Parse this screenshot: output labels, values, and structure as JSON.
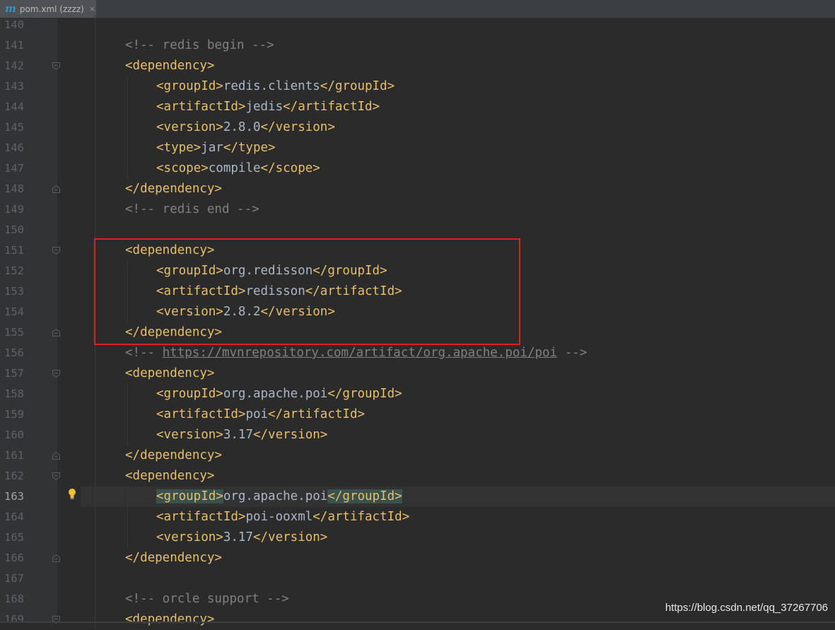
{
  "tab": {
    "icon": "maven-m-icon",
    "label": "pom.xml (zzzz)",
    "close": "×",
    "letter": "m"
  },
  "current_line": "163",
  "lines": [
    {
      "n": "140",
      "indent": 0,
      "parts": []
    },
    {
      "n": "141",
      "indent": 0,
      "parts": [
        [
          "cmt",
          "<!-- redis begin -->"
        ]
      ]
    },
    {
      "n": "142",
      "indent": 0,
      "fold": "open",
      "parts": [
        [
          "tag",
          "<dependency>"
        ]
      ]
    },
    {
      "n": "143",
      "indent": 1,
      "parts": [
        [
          "tag",
          "<groupId>"
        ],
        [
          "txt",
          "redis.clients"
        ],
        [
          "tag",
          "</groupId>"
        ]
      ]
    },
    {
      "n": "144",
      "indent": 1,
      "parts": [
        [
          "tag",
          "<artifactId>"
        ],
        [
          "txt",
          "jedis"
        ],
        [
          "tag",
          "</artifactId>"
        ]
      ]
    },
    {
      "n": "145",
      "indent": 1,
      "parts": [
        [
          "tag",
          "<version>"
        ],
        [
          "txt",
          "2.8.0"
        ],
        [
          "tag",
          "</version>"
        ]
      ]
    },
    {
      "n": "146",
      "indent": 1,
      "parts": [
        [
          "tag",
          "<type>"
        ],
        [
          "txt",
          "jar"
        ],
        [
          "tag",
          "</type>"
        ]
      ]
    },
    {
      "n": "147",
      "indent": 1,
      "parts": [
        [
          "tag",
          "<scope>"
        ],
        [
          "txt",
          "compile"
        ],
        [
          "tag",
          "</scope>"
        ]
      ]
    },
    {
      "n": "148",
      "indent": 0,
      "fold": "close",
      "parts": [
        [
          "tag",
          "</dependency>"
        ]
      ]
    },
    {
      "n": "149",
      "indent": 0,
      "parts": [
        [
          "cmt",
          "<!-- redis end -->"
        ]
      ]
    },
    {
      "n": "150",
      "indent": 0,
      "parts": []
    },
    {
      "n": "151",
      "indent": 0,
      "fold": "open",
      "parts": [
        [
          "tag",
          "<dependency>"
        ]
      ]
    },
    {
      "n": "152",
      "indent": 1,
      "parts": [
        [
          "tag",
          "<groupId>"
        ],
        [
          "txt",
          "org.redisson"
        ],
        [
          "tag",
          "</groupId>"
        ]
      ]
    },
    {
      "n": "153",
      "indent": 1,
      "parts": [
        [
          "tag",
          "<artifactId>"
        ],
        [
          "txt",
          "redisson"
        ],
        [
          "tag",
          "</artifactId>"
        ]
      ]
    },
    {
      "n": "154",
      "indent": 1,
      "parts": [
        [
          "tag",
          "<version>"
        ],
        [
          "txt",
          "2.8.2"
        ],
        [
          "tag",
          "</version>"
        ]
      ]
    },
    {
      "n": "155",
      "indent": 0,
      "fold": "close",
      "parts": [
        [
          "tag",
          "</dependency>"
        ]
      ]
    },
    {
      "n": "156",
      "indent": 0,
      "parts": [
        [
          "cmt",
          "<!-- "
        ],
        [
          "link",
          "https://mvnrepository.com/artifact/org.apache.poi/poi"
        ],
        [
          "cmt",
          " -->"
        ]
      ]
    },
    {
      "n": "157",
      "indent": 0,
      "fold": "open",
      "parts": [
        [
          "tag",
          "<dependency>"
        ]
      ]
    },
    {
      "n": "158",
      "indent": 1,
      "parts": [
        [
          "tag",
          "<groupId>"
        ],
        [
          "txt",
          "org.apache.poi"
        ],
        [
          "tag",
          "</groupId>"
        ]
      ]
    },
    {
      "n": "159",
      "indent": 1,
      "parts": [
        [
          "tag",
          "<artifactId>"
        ],
        [
          "txt",
          "poi"
        ],
        [
          "tag",
          "</artifactId>"
        ]
      ]
    },
    {
      "n": "160",
      "indent": 1,
      "parts": [
        [
          "tag",
          "<version>"
        ],
        [
          "txt",
          "3.17"
        ],
        [
          "tag",
          "</version>"
        ]
      ]
    },
    {
      "n": "161",
      "indent": 0,
      "fold": "close",
      "parts": [
        [
          "tag",
          "</dependency>"
        ]
      ]
    },
    {
      "n": "162",
      "indent": 0,
      "fold": "open",
      "parts": [
        [
          "tag",
          "<dependency>"
        ]
      ]
    },
    {
      "n": "163",
      "indent": 1,
      "bulb": true,
      "parts": [
        [
          "match",
          "<groupId>"
        ],
        [
          "txt",
          "org.apache.poi"
        ],
        [
          "match",
          "</groupId>"
        ]
      ]
    },
    {
      "n": "164",
      "indent": 1,
      "parts": [
        [
          "tag",
          "<artifactId>"
        ],
        [
          "txt",
          "poi-ooxml"
        ],
        [
          "tag",
          "</artifactId>"
        ]
      ]
    },
    {
      "n": "165",
      "indent": 1,
      "parts": [
        [
          "tag",
          "<version>"
        ],
        [
          "txt",
          "3.17"
        ],
        [
          "tag",
          "</version>"
        ]
      ]
    },
    {
      "n": "166",
      "indent": 0,
      "fold": "close",
      "parts": [
        [
          "tag",
          "</dependency>"
        ]
      ]
    },
    {
      "n": "167",
      "indent": 0,
      "parts": []
    },
    {
      "n": "168",
      "indent": 0,
      "parts": [
        [
          "cmt",
          "<!-- orcle support -->"
        ]
      ]
    },
    {
      "n": "169",
      "indent": 0,
      "fold": "open",
      "parts": [
        [
          "tag",
          "<dependency>"
        ]
      ]
    }
  ],
  "watermark": "https://blog.csdn.net/qq_37267706",
  "colors": {
    "highlight_box": "#e02020",
    "tag": "#e8bf6a",
    "comment": "#808080",
    "text": "#a9b7c6"
  }
}
